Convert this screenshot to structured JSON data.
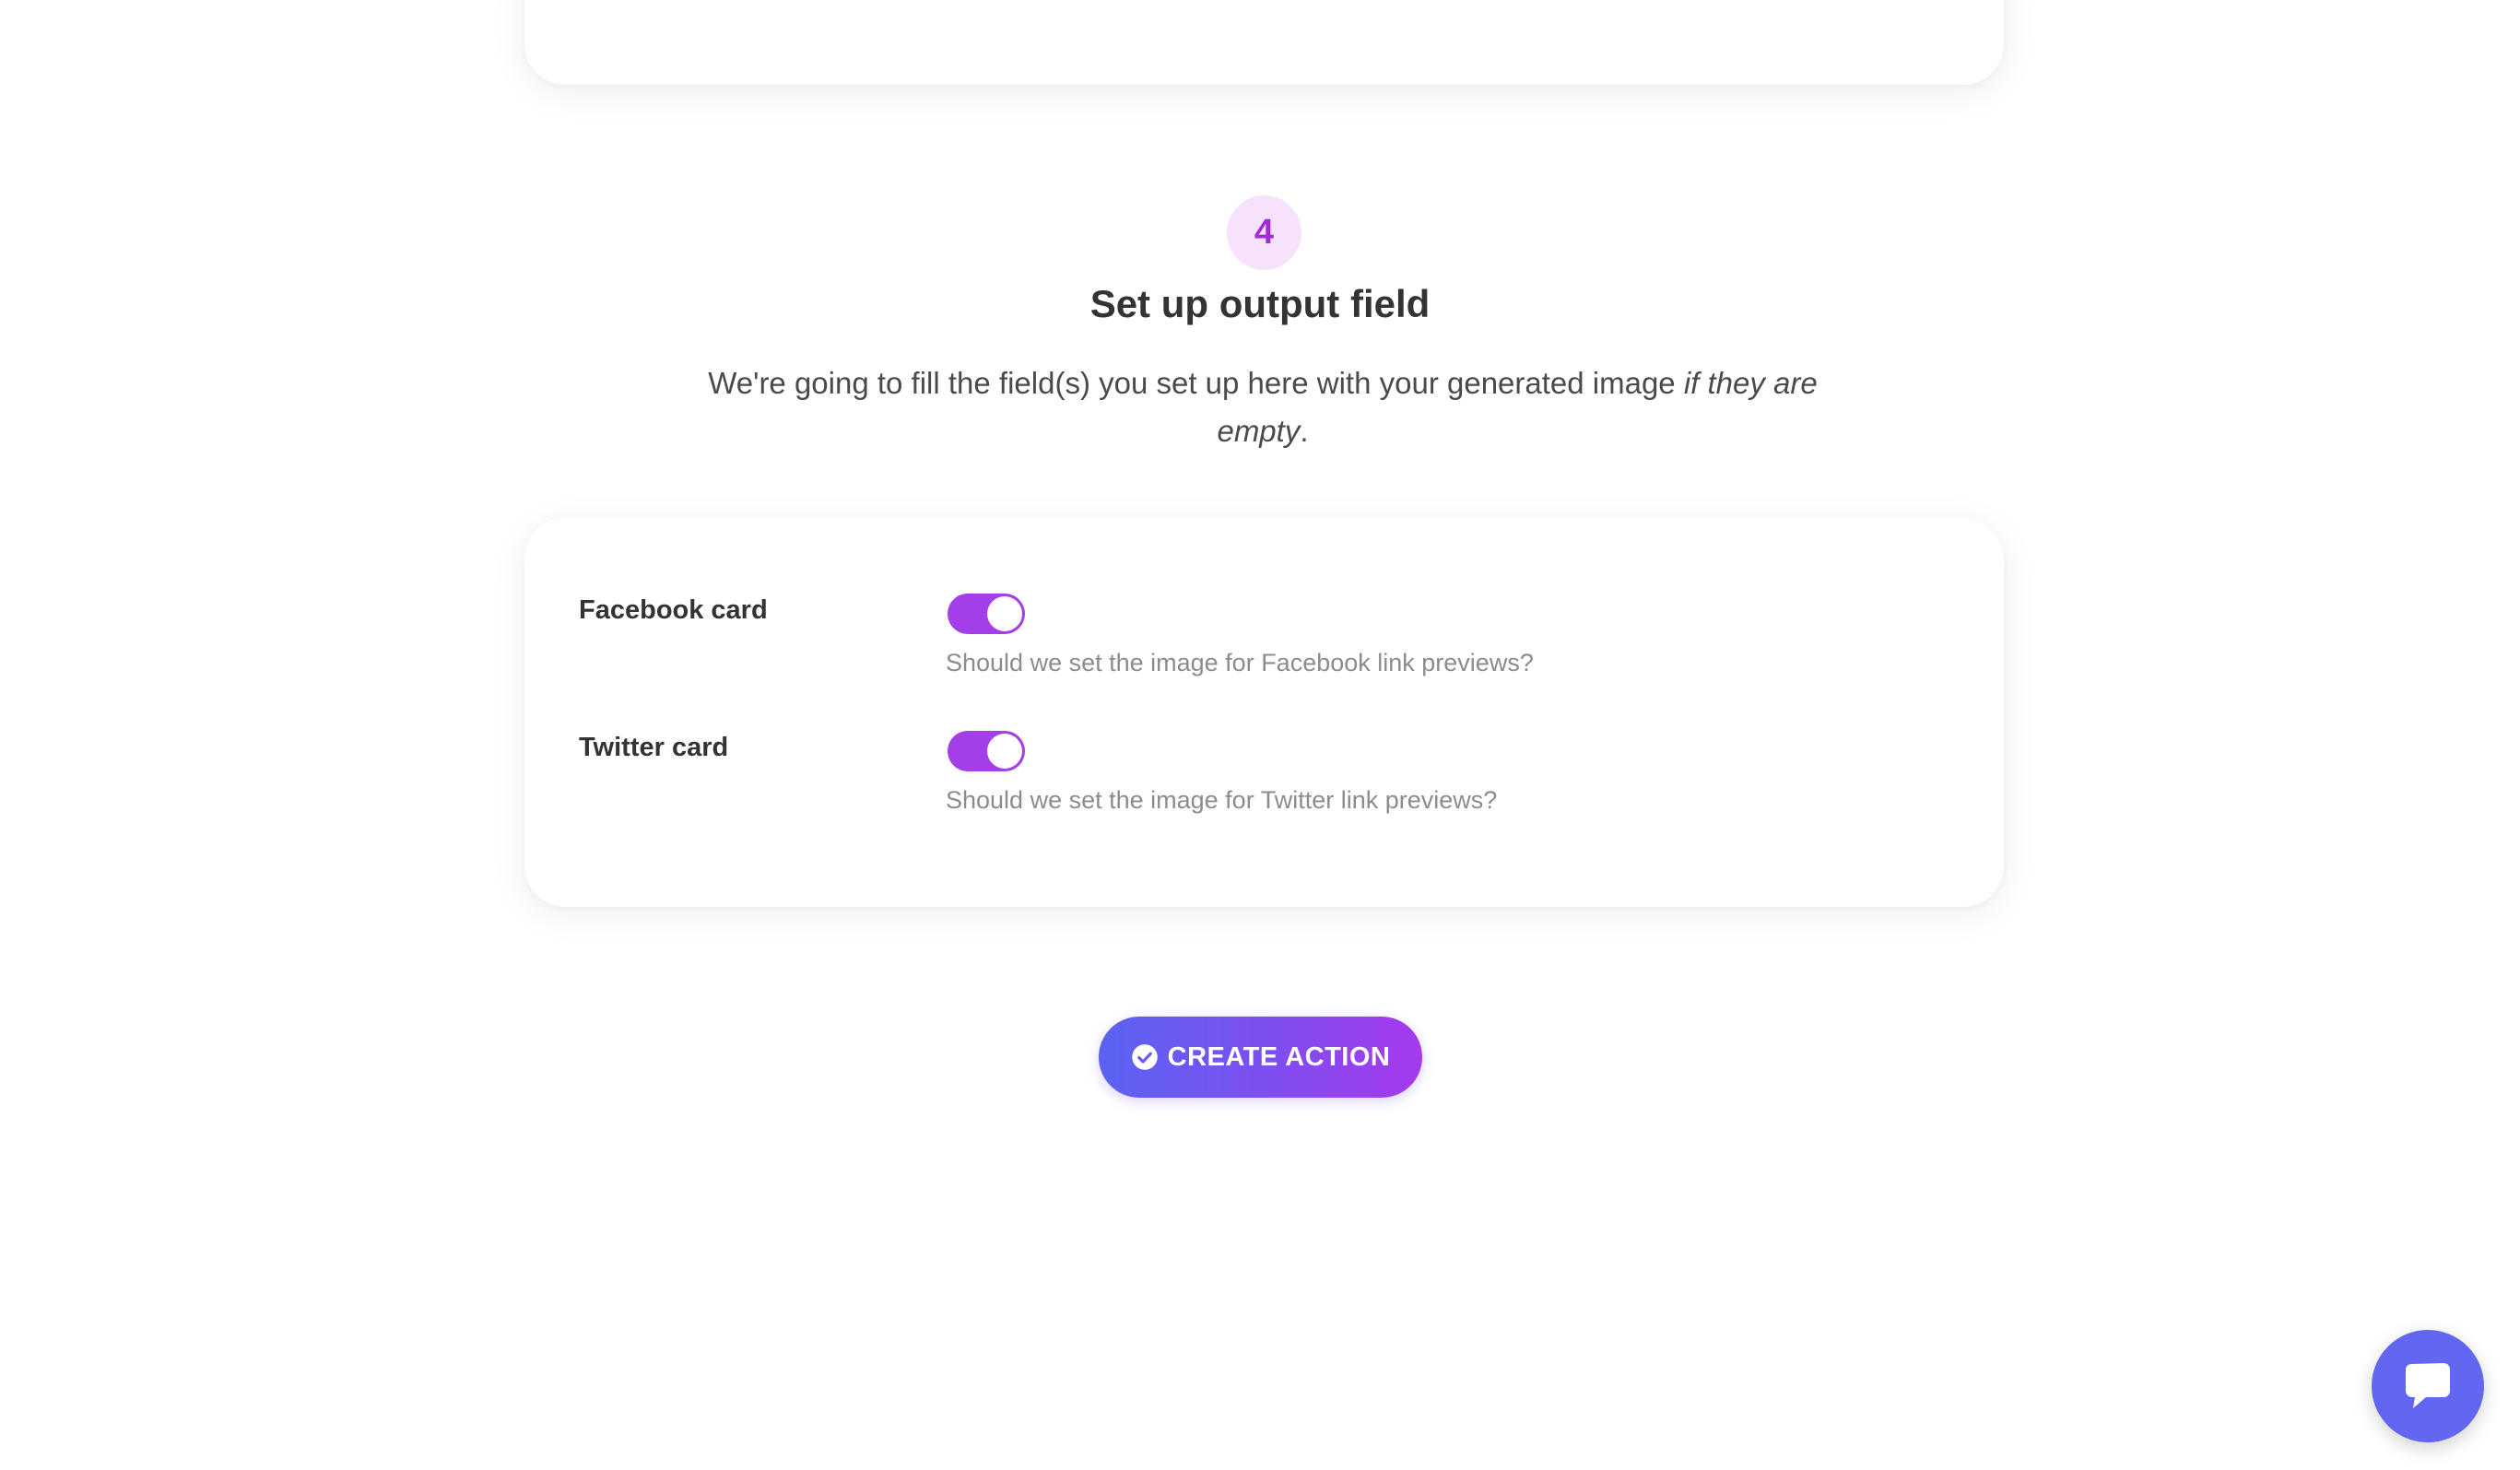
{
  "step": {
    "number": "4",
    "title": "Set up output field",
    "description_normal": "We're going to fill the field(s) you set up here with your generated image ",
    "description_italic": "if they are empty",
    "description_end": "."
  },
  "fields": {
    "facebook": {
      "label": "Facebook card",
      "enabled": true,
      "help": "Should we set the image for Facebook link previews?"
    },
    "twitter": {
      "label": "Twitter card",
      "enabled": true,
      "help": "Should we set the image for Twitter link previews?"
    }
  },
  "actions": {
    "create_label": "CREATE ACTION",
    "create_icon": "check-circle-icon"
  },
  "chat": {
    "icon": "chat-bubble-icon"
  },
  "colors": {
    "accent": "#a33ee8",
    "step_bg": "#f6e3fb",
    "step_text": "#a22ad9",
    "button_gradient_start": "#5a63f2",
    "button_gradient_end": "#a639ee",
    "chat_bg": "#6366f1"
  }
}
